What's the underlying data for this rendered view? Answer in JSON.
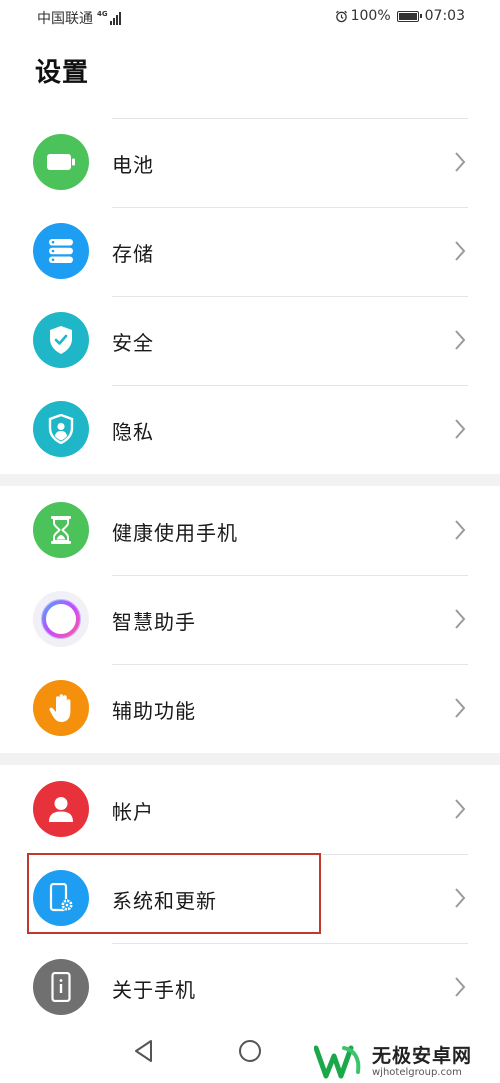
{
  "status_bar": {
    "carrier": "中国联通",
    "network": "4G",
    "battery": "100%",
    "time": "07:03"
  },
  "page_title": "设置",
  "groups": [
    {
      "items": [
        {
          "label": "电池",
          "icon": "battery-icon",
          "color": "#4cc25a"
        },
        {
          "label": "存储",
          "icon": "storage-icon",
          "color": "#1e9ef2"
        },
        {
          "label": "安全",
          "icon": "shield-check-icon",
          "color": "#1fb6c8"
        },
        {
          "label": "隐私",
          "icon": "privacy-shield-icon",
          "color": "#1fb6c8"
        }
      ]
    },
    {
      "items": [
        {
          "label": "健康使用手机",
          "icon": "hourglass-icon",
          "color": "#4cc25a"
        },
        {
          "label": "智慧助手",
          "icon": "assistant-ring-icon",
          "color": "#f0f0f6"
        },
        {
          "label": "辅助功能",
          "icon": "hand-icon",
          "color": "#f5900d"
        }
      ]
    },
    {
      "items": [
        {
          "label": "帐户",
          "icon": "account-icon",
          "color": "#e8323b"
        },
        {
          "label": "系统和更新",
          "icon": "phone-gear-icon",
          "color": "#1e9ef2"
        },
        {
          "label": "关于手机",
          "icon": "phone-info-icon",
          "color": "#707070"
        }
      ]
    }
  ],
  "watermark": {
    "title": "无极安卓网",
    "url": "wjhotelgroup.com"
  }
}
